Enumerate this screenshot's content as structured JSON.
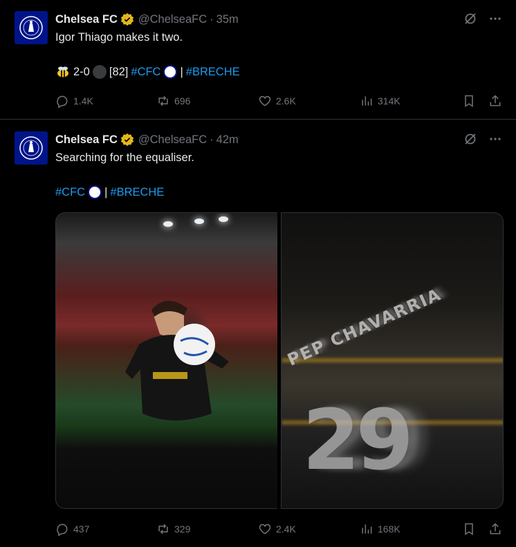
{
  "tweets": [
    {
      "name": "Chelsea FC",
      "handle": "@ChelseaFC",
      "sep": "·",
      "time": "35m",
      "text": "Igor Thiago makes it two.",
      "score": "2-0",
      "minute": "[82]",
      "tag1": "#CFC",
      "divider": "|",
      "tag2": "#BRECHE",
      "replies": "1.4K",
      "reposts": "696",
      "likes": "2.6K",
      "views": "314K"
    },
    {
      "name": "Chelsea FC",
      "handle": "@ChelseaFC",
      "sep": "·",
      "time": "42m",
      "text": "Searching for the equaliser.",
      "tag1": "#CFC",
      "divider": "|",
      "tag2": "#BRECHE",
      "replies": "437",
      "reposts": "329",
      "likes": "2.4K",
      "views": "168K",
      "media_right": {
        "jersey_name": "PEP CHAVARRIA",
        "jersey_number": "29"
      }
    }
  ],
  "colors": {
    "accent": "#1d9bf0",
    "muted": "#71767b",
    "verified": "#e2b719",
    "chelsea_blue": "#001489"
  },
  "icons": [
    "grok-icon",
    "more-icon",
    "reply-icon",
    "repost-icon",
    "like-icon",
    "views-icon",
    "bookmark-icon",
    "share-icon",
    "verified-icon",
    "bee-emoji-icon"
  ]
}
